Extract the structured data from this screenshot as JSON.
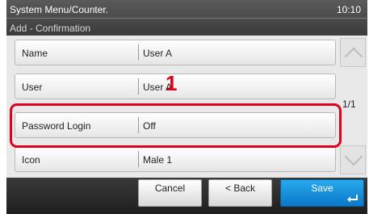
{
  "header": {
    "title": "System Menu/Counter.",
    "time": "10:10",
    "subtitle": "Add - Confirmation"
  },
  "rows": [
    {
      "label": "Name",
      "value": "User A"
    },
    {
      "label": "User",
      "value": "User A"
    },
    {
      "label": "Password Login",
      "value": "Off"
    },
    {
      "label": "Icon",
      "value": "Male 1"
    }
  ],
  "callout": "1",
  "page_indicator": "1/1",
  "buttons": {
    "cancel": "Cancel",
    "back": "< Back",
    "save": "Save"
  },
  "icons": {
    "scroll_up": "chevron-up-icon",
    "scroll_down": "chevron-down-icon",
    "enter": "enter-icon"
  },
  "colors": {
    "highlight": "#e0001b",
    "save_button": "#1890dc"
  }
}
